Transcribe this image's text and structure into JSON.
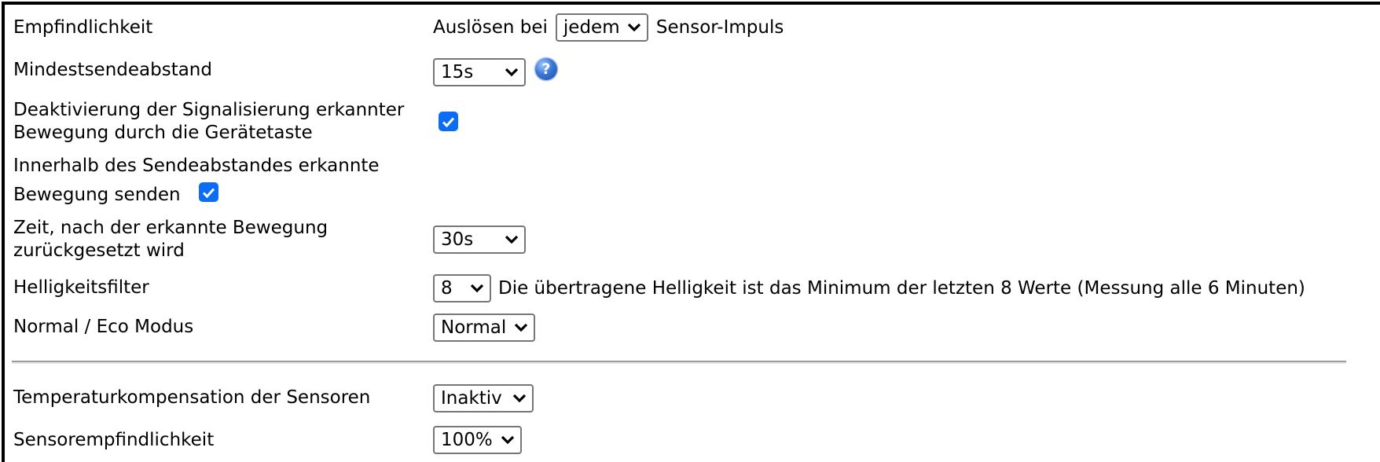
{
  "settings": {
    "sensitivity": {
      "label": "Empfindlichkeit",
      "prefix": "Auslösen bei",
      "selected": "jedem",
      "suffix": "Sensor-Impuls"
    },
    "min_send_interval": {
      "label": "Mindestsendeabstand",
      "selected": "15s",
      "help_icon": "question-mark"
    },
    "disable_signaling": {
      "label_line1": "Deaktivierung der Signalisierung erkannter",
      "label_line2": "Bewegung durch die Gerätetaste",
      "checked": true
    },
    "send_within_interval": {
      "label_line1": "Innerhalb des Sendeabstandes erkannte",
      "label_line2": "Bewegung senden",
      "checked": true
    },
    "reset_time": {
      "label_line1": "Zeit, nach der erkannte Bewegung",
      "label_line2": "zurückgesetzt wird",
      "selected": "30s"
    },
    "brightness_filter": {
      "label": "Helligkeitsfilter",
      "selected": "8",
      "description": "Die übertragene Helligkeit ist das Minimum der letzten 8 Werte (Messung alle 6 Minuten)"
    },
    "mode": {
      "label": "Normal / Eco Modus",
      "selected": "Normal"
    },
    "temp_compensation": {
      "label": "Temperaturkompensation der Sensoren",
      "selected": "Inaktiv"
    },
    "sensor_sensitivity": {
      "label": "Sensorempfindlichkeit",
      "selected": "100%"
    }
  },
  "colors": {
    "checkbox_accent": "#0b6cf5",
    "border": "#000000",
    "select_border": "#767676",
    "separator": "#999999"
  }
}
